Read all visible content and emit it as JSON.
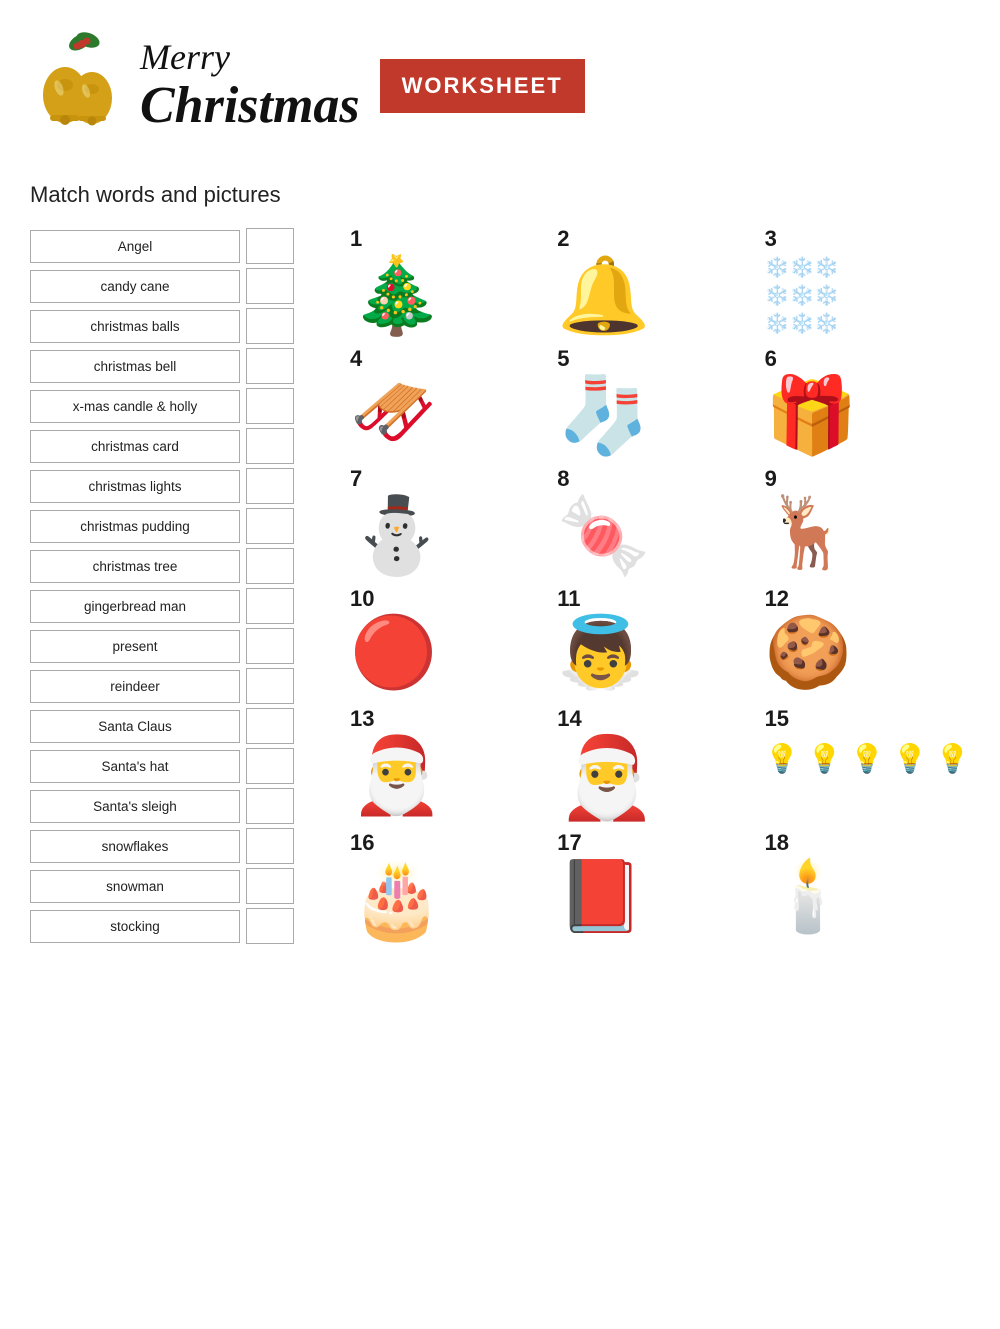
{
  "header": {
    "bell_emoji": "🔔",
    "holly_emoji": "🌿",
    "merry_line": "Merry",
    "christmas_line": "Christmas",
    "worksheet_label": "WORKSHEET"
  },
  "subtitle": "Match words and pictures",
  "words": [
    "Angel",
    "candy cane",
    "christmas balls",
    "christmas bell",
    "x-mas candle & holly",
    "christmas card",
    "christmas lights",
    "christmas pudding",
    "christmas tree",
    "gingerbread man",
    "present",
    "reindeer",
    "Santa Claus",
    "Santa's hat",
    "Santa's sleigh",
    "snowflakes",
    "snowman",
    "stocking"
  ],
  "pictures": [
    {
      "number": "1",
      "emoji": "🎄",
      "label": "christmas tree",
      "size": "large"
    },
    {
      "number": "2",
      "emoji": "🔔",
      "label": "christmas bell",
      "size": "large"
    },
    {
      "number": "3",
      "emoji": "❄️",
      "label": "snowflakes",
      "size": "snowflakes"
    },
    {
      "number": "4",
      "emoji": "🛷",
      "label": "santa's sleigh",
      "size": "large"
    },
    {
      "number": "5",
      "emoji": "🧦",
      "label": "stocking",
      "size": "large"
    },
    {
      "number": "6",
      "emoji": "🎁",
      "label": "present",
      "size": "large"
    },
    {
      "number": "7",
      "emoji": "⛄",
      "label": "snowman",
      "size": "large"
    },
    {
      "number": "8",
      "emoji": "🍬",
      "label": "candy cane",
      "size": "large"
    },
    {
      "number": "9",
      "emoji": "🦌",
      "label": "reindeer",
      "size": "large"
    },
    {
      "number": "10",
      "emoji": "🎄🔴",
      "label": "christmas balls",
      "size": "large"
    },
    {
      "number": "11",
      "emoji": "👼",
      "label": "angel",
      "size": "large"
    },
    {
      "number": "12",
      "emoji": "🍪",
      "label": "gingerbread man",
      "size": "large"
    },
    {
      "number": "13",
      "emoji": "🎅🧢",
      "label": "santa's hat",
      "size": "large"
    },
    {
      "number": "14",
      "emoji": "🎅",
      "label": "santa claus",
      "size": "large"
    },
    {
      "number": "15",
      "emoji": "💡",
      "label": "christmas lights",
      "size": "large"
    },
    {
      "number": "16",
      "emoji": "🎂",
      "label": "christmas pudding",
      "size": "large"
    },
    {
      "number": "17",
      "emoji": "📗",
      "label": "christmas card",
      "size": "large"
    },
    {
      "number": "18",
      "emoji": "🕯️",
      "label": "x-mas candle & holly",
      "size": "large"
    }
  ]
}
